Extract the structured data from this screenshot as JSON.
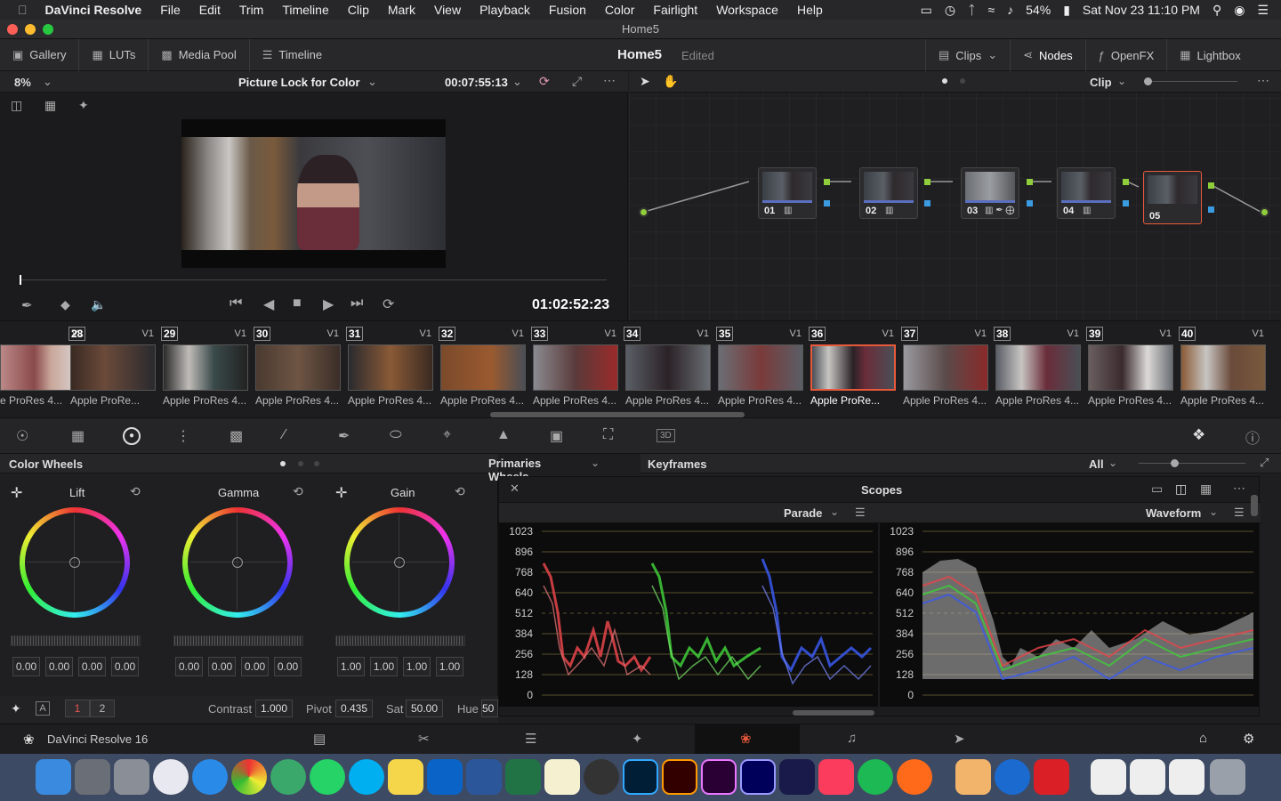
{
  "menubar": {
    "app": "DaVinci Resolve",
    "items": [
      "File",
      "Edit",
      "Trim",
      "Timeline",
      "Clip",
      "Mark",
      "View",
      "Playback",
      "Fusion",
      "Color",
      "Fairlight",
      "Workspace",
      "Help"
    ],
    "battery": "54%",
    "datetime": "Sat Nov 23  11:10 PM"
  },
  "window": {
    "title": "Home5"
  },
  "toolbar": {
    "gallery": "Gallery",
    "luts": "LUTs",
    "media_pool": "Media Pool",
    "timeline": "Timeline",
    "project": "Home5",
    "status": "Edited",
    "clips": "Clips",
    "nodes": "Nodes",
    "openfx": "OpenFX",
    "lightbox": "Lightbox"
  },
  "viewer": {
    "zoom": "8%",
    "timeline_name": "Picture Lock for Color",
    "duration": "00:07:55:13",
    "timecode": "01:02:52:23"
  },
  "node_editor": {
    "mode": "Clip",
    "nodes": [
      "01",
      "02",
      "03",
      "04",
      "05"
    ]
  },
  "clips": [
    {
      "num": "",
      "track": "V1",
      "name": "e ProRes 4..."
    },
    {
      "num": "28",
      "track": "V1",
      "name": "Apple ProRe..."
    },
    {
      "num": "29",
      "track": "V1",
      "name": "Apple ProRes 4..."
    },
    {
      "num": "30",
      "track": "V1",
      "name": "Apple ProRes 4..."
    },
    {
      "num": "31",
      "track": "V1",
      "name": "Apple ProRes 4..."
    },
    {
      "num": "32",
      "track": "V1",
      "name": "Apple ProRes 4..."
    },
    {
      "num": "33",
      "track": "V1",
      "name": "Apple ProRes 4..."
    },
    {
      "num": "34",
      "track": "V1",
      "name": "Apple ProRes 4..."
    },
    {
      "num": "35",
      "track": "V1",
      "name": "Apple ProRes 4..."
    },
    {
      "num": "36",
      "track": "V1",
      "name": "Apple ProRe..."
    },
    {
      "num": "37",
      "track": "V1",
      "name": "Apple ProRes 4..."
    },
    {
      "num": "38",
      "track": "V1",
      "name": "Apple ProRes 4..."
    },
    {
      "num": "39",
      "track": "V1",
      "name": "Apple ProRes 4..."
    },
    {
      "num": "40",
      "track": "V1",
      "name": "Apple ProRes 4..."
    }
  ],
  "color_wheels": {
    "title": "Color Wheels",
    "mode": "Primaries Wheels",
    "wheels": [
      {
        "name": "Lift",
        "values": [
          "0.00",
          "0.00",
          "0.00",
          "0.00"
        ]
      },
      {
        "name": "Gamma",
        "values": [
          "0.00",
          "0.00",
          "0.00",
          "0.00"
        ]
      },
      {
        "name": "Gain",
        "values": [
          "1.00",
          "1.00",
          "1.00",
          "1.00"
        ]
      }
    ],
    "page1": "1",
    "page2": "2",
    "contrast_label": "Contrast",
    "contrast": "1.000",
    "pivot_label": "Pivot",
    "pivot": "0.435",
    "sat_label": "Sat",
    "sat": "50.00",
    "hue_label": "Hue",
    "hue": "50"
  },
  "keyframes": {
    "title": "Keyframes",
    "filter": "All"
  },
  "scopes": {
    "title": "Scopes",
    "left": "Parade",
    "right": "Waveform",
    "ticks": [
      "1023",
      "896",
      "768",
      "640",
      "512",
      "384",
      "256",
      "128",
      "0"
    ]
  },
  "pagebar": {
    "app": "DaVinci Resolve 16"
  },
  "colors": {
    "accent": "#e8593c",
    "node_green": "#8fce3a",
    "node_blue": "#3b9be0"
  }
}
